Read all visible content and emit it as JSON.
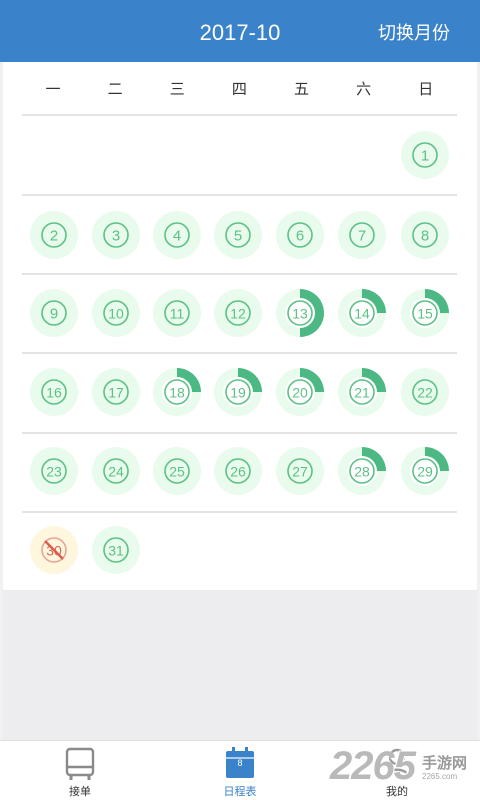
{
  "header": {
    "title": "2017-10",
    "switch_label": "切换月份",
    "background": "#3a82c9"
  },
  "weekdays": [
    "一",
    "二",
    "三",
    "四",
    "五",
    "六",
    "日"
  ],
  "calendar": {
    "start_weekday_index": 6,
    "circle_color": "#e9fbec",
    "ring_color": "#5cc185",
    "fill_color": "#4cb884",
    "today_color": "#fff6de",
    "days": [
      {
        "day": "1",
        "fill": 0
      },
      {
        "day": "2",
        "fill": 0
      },
      {
        "day": "3",
        "fill": 0
      },
      {
        "day": "4",
        "fill": 0
      },
      {
        "day": "5",
        "fill": 0
      },
      {
        "day": "6",
        "fill": 0
      },
      {
        "day": "7",
        "fill": 0
      },
      {
        "day": "8",
        "fill": 0
      },
      {
        "day": "9",
        "fill": 0
      },
      {
        "day": "10",
        "fill": 0
      },
      {
        "day": "11",
        "fill": 0
      },
      {
        "day": "12",
        "fill": 0
      },
      {
        "day": "13",
        "fill": 0.5
      },
      {
        "day": "14",
        "fill": 0.25
      },
      {
        "day": "15",
        "fill": 0.25
      },
      {
        "day": "16",
        "fill": 0
      },
      {
        "day": "17",
        "fill": 0
      },
      {
        "day": "18",
        "fill": 0.25
      },
      {
        "day": "19",
        "fill": 0.25
      },
      {
        "day": "20",
        "fill": 0.25
      },
      {
        "day": "21",
        "fill": 0.25
      },
      {
        "day": "22",
        "fill": 0
      },
      {
        "day": "23",
        "fill": 0
      },
      {
        "day": "24",
        "fill": 0
      },
      {
        "day": "25",
        "fill": 0
      },
      {
        "day": "26",
        "fill": 0
      },
      {
        "day": "27",
        "fill": 0
      },
      {
        "day": "28",
        "fill": 0.25
      },
      {
        "day": "29",
        "fill": 0.25
      },
      {
        "day": "30",
        "fill": 0,
        "today": true
      },
      {
        "day": "31",
        "fill": 0
      }
    ]
  },
  "bottom_nav": {
    "items": [
      {
        "label": "接单",
        "icon": "bus-icon",
        "active": false
      },
      {
        "label": "日程表",
        "icon": "calendar-icon",
        "active": true,
        "badge": "8"
      },
      {
        "label": "我的",
        "icon": "user-icon",
        "active": false
      }
    ],
    "active_color": "#3a82c9"
  },
  "watermark": {
    "number": "2265",
    "text": "手游网",
    "url": "2265.com"
  }
}
